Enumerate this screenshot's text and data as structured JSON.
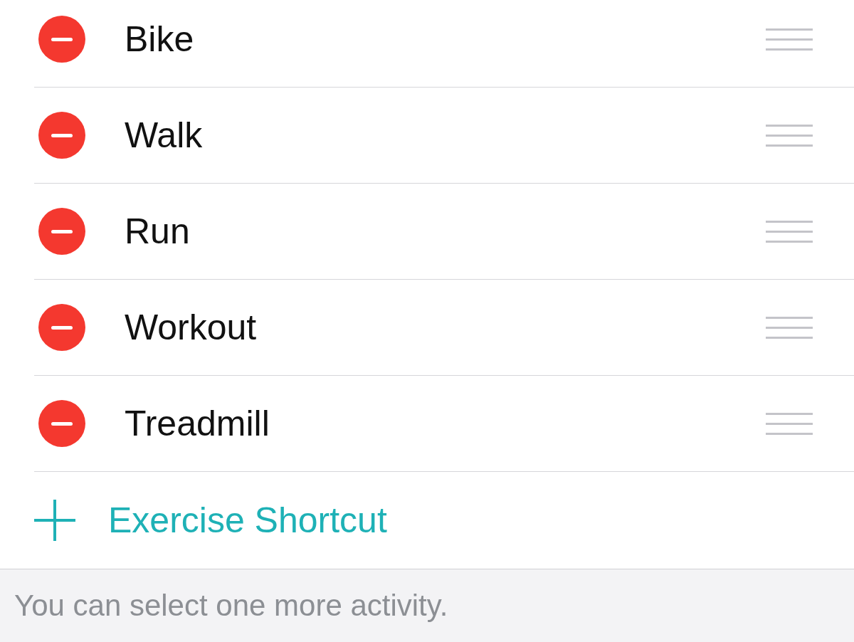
{
  "activities": [
    {
      "label": "Bike"
    },
    {
      "label": "Walk"
    },
    {
      "label": "Run"
    },
    {
      "label": "Workout"
    },
    {
      "label": "Treadmill"
    }
  ],
  "add_button": {
    "label": "Exercise Shortcut"
  },
  "footer": {
    "text": "You can select one more activity."
  }
}
